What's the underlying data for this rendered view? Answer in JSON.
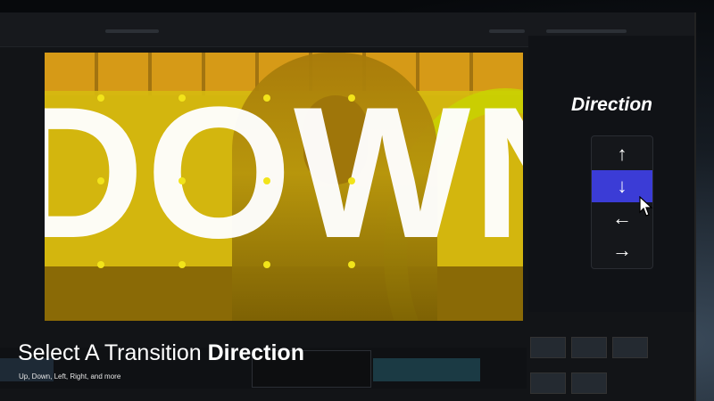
{
  "panel": {
    "title": "Direction",
    "buttons": [
      {
        "name": "up",
        "glyph": "↑",
        "selected": false
      },
      {
        "name": "down",
        "glyph": "↓",
        "selected": true
      },
      {
        "name": "left",
        "glyph": "←",
        "selected": false
      },
      {
        "name": "right",
        "glyph": "→",
        "selected": false
      }
    ]
  },
  "preview": {
    "big_text": "DOWN"
  },
  "caption": {
    "lead": "Select A Transition ",
    "bold": "Direction",
    "sub": "Up, Down, Left, Right, and more"
  },
  "colors": {
    "accent": "#3b3cd6",
    "handle": "#f2e41a",
    "overlay_yellow": "#d6ba10"
  }
}
